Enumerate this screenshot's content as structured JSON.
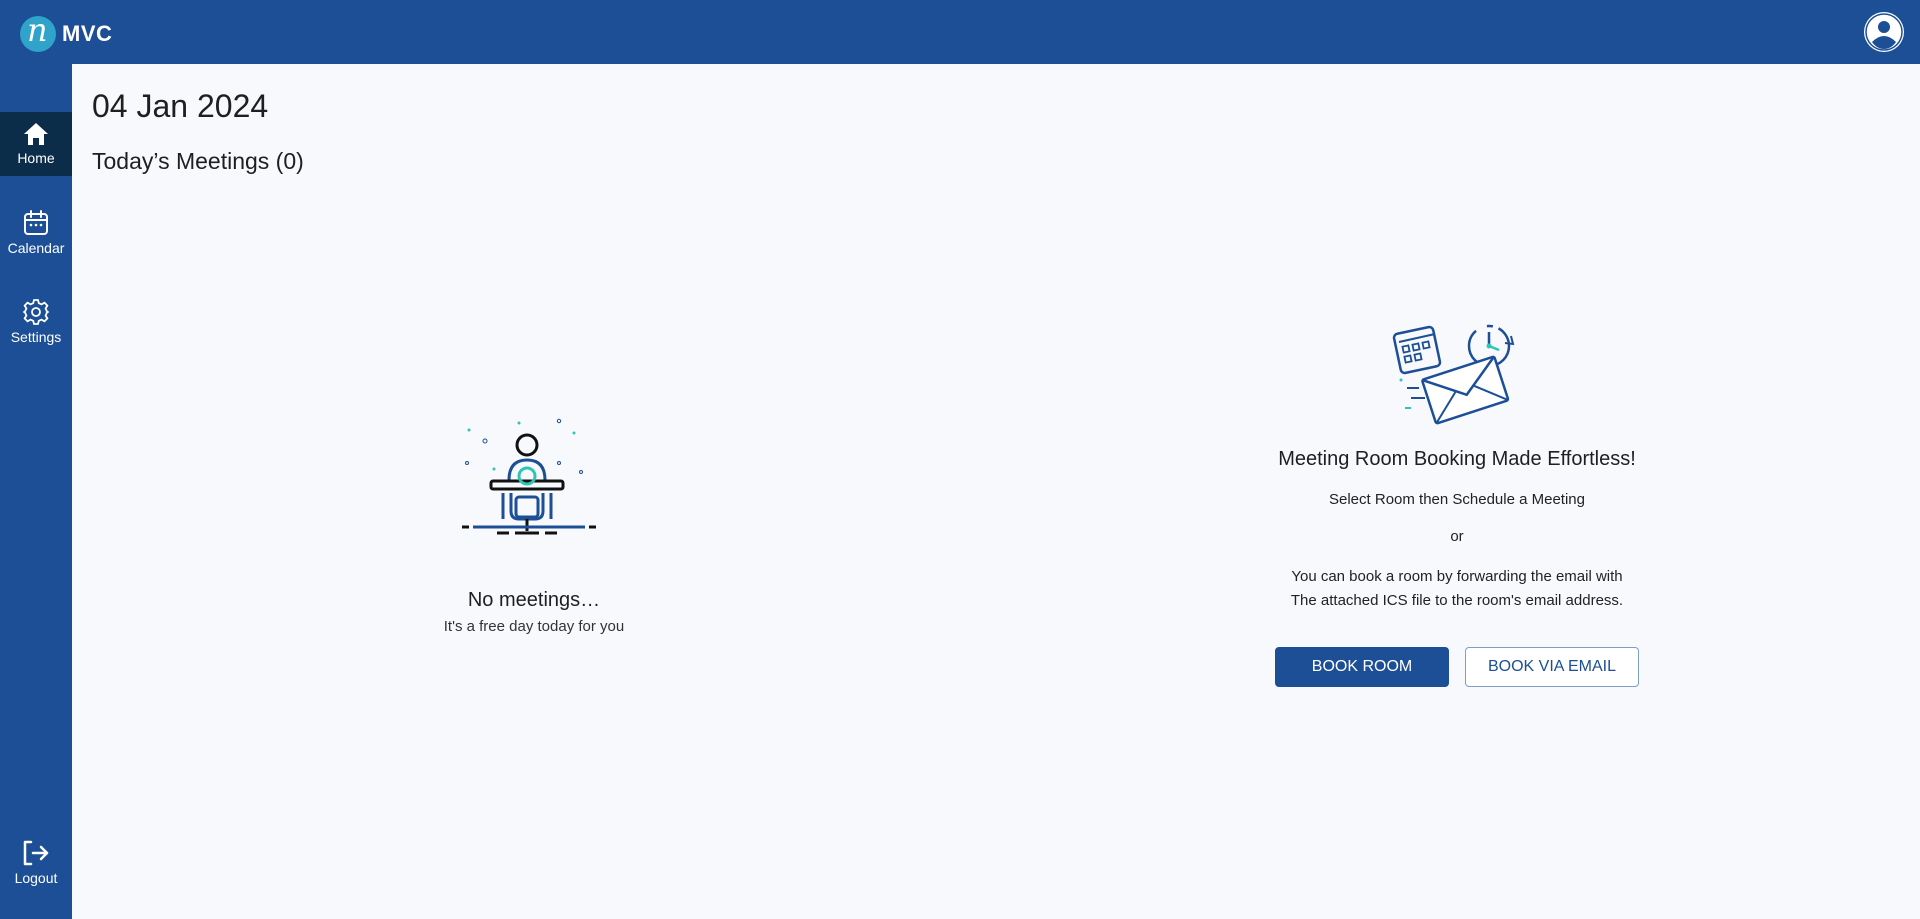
{
  "header": {
    "logo_letter": "n",
    "logo_text": "MVC"
  },
  "sidebar": {
    "items": [
      {
        "label": "Home",
        "icon": "home-icon",
        "active": true
      },
      {
        "label": "Calendar",
        "icon": "calendar-icon",
        "active": false
      },
      {
        "label": "Settings",
        "icon": "gear-icon",
        "active": false
      }
    ],
    "logout": {
      "label": "Logout",
      "icon": "logout-icon"
    }
  },
  "main": {
    "date": "04 Jan 2024",
    "meetings_title": "Today’s Meetings (0)"
  },
  "empty_state": {
    "title": "No meetings…",
    "subtitle": "It's a free day today for you"
  },
  "booking": {
    "title": "Meeting Room Booking Made Effortless!",
    "line1": "Select Room then Schedule a Meeting",
    "or": "or",
    "desc_line1": "You can book a room by forwarding the email with",
    "desc_line2": "The attached ICS file to the room's email address.",
    "book_room_label": "BOOK ROOM",
    "book_email_label": "BOOK VIA EMAIL"
  },
  "colors": {
    "brand": "#1c4f96",
    "active_nav": "#0c2d4a",
    "accent": "#2ec4b6",
    "background": "#f7f9fc"
  }
}
